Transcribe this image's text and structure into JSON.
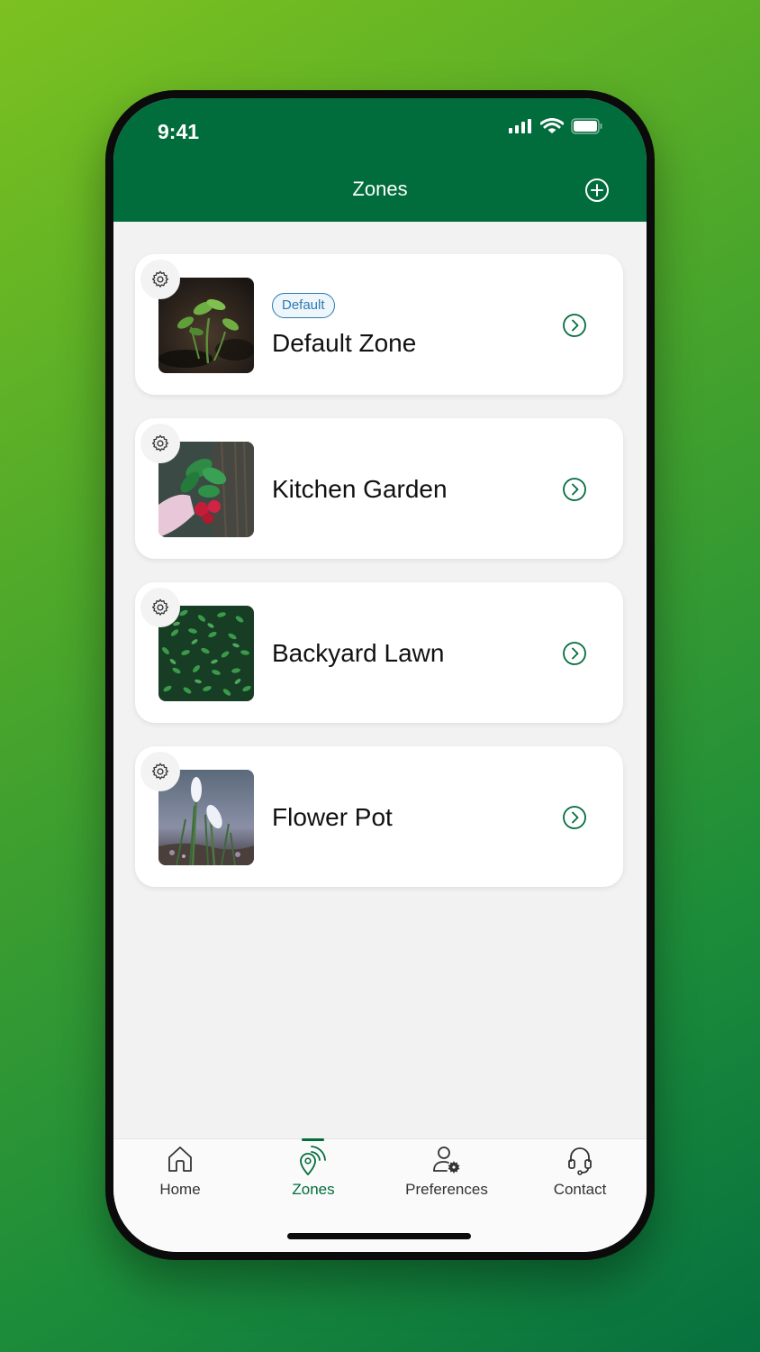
{
  "status_bar": {
    "time": "9:41"
  },
  "header": {
    "title": "Zones",
    "add_icon": "plus-circle-icon"
  },
  "zones": [
    {
      "name": "Default Zone",
      "badge": "Default",
      "image": "seedling-photo"
    },
    {
      "name": "Kitchen Garden",
      "badge": null,
      "image": "radish-photo"
    },
    {
      "name": "Backyard Lawn",
      "badge": null,
      "image": "lawn-photo"
    },
    {
      "name": "Flower Pot",
      "badge": null,
      "image": "crocus-photo"
    }
  ],
  "tabs": [
    {
      "label": "Home",
      "icon": "home-icon"
    },
    {
      "label": "Zones",
      "icon": "zone-signal-icon",
      "active": true
    },
    {
      "label": "Preferences",
      "icon": "user-settings-icon"
    },
    {
      "label": "Contact",
      "icon": "headset-icon"
    }
  ],
  "colors": {
    "brand": "#026d3c",
    "badge": "#2b7bb0",
    "background": "#f1f2f1"
  }
}
